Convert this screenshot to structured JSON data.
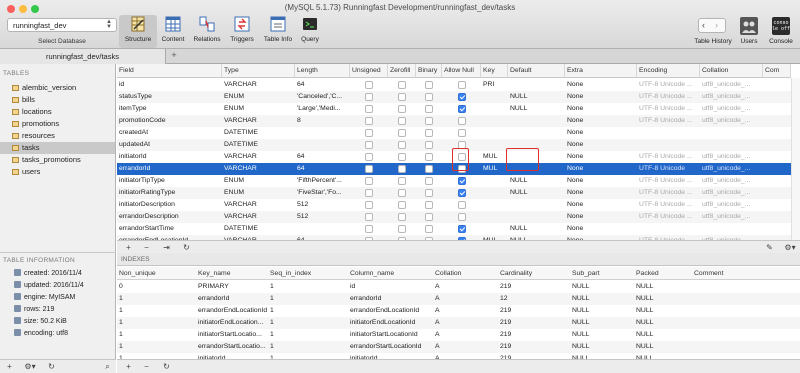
{
  "window": {
    "title": "(MySQL 5.1.73) Runningfast Development/runningfast_dev/tasks"
  },
  "toolbar": {
    "database": "runningfast_dev",
    "database_label": "Select Database",
    "buttons": [
      {
        "label": "Structure"
      },
      {
        "label": "Content"
      },
      {
        "label": "Relations"
      },
      {
        "label": "Triggers"
      },
      {
        "label": "Table Info"
      },
      {
        "label": "Query"
      }
    ],
    "right": [
      {
        "label": "Table History"
      },
      {
        "label": "Users"
      },
      {
        "label": "Console",
        "badge": "conso le off"
      }
    ]
  },
  "tab": {
    "label": "runningfast_dev/tasks",
    "add": "+"
  },
  "sidebar": {
    "tables_heading": "TABLES",
    "tables": [
      "alembic_version",
      "bills",
      "locations",
      "promotions",
      "resources",
      "tasks",
      "tasks_promotions",
      "users"
    ],
    "selected": "tasks",
    "info_heading": "TABLE INFORMATION",
    "info": [
      "created: 2016/11/4",
      "updated: 2016/11/4",
      "engine: MyISAM",
      "rows: 219",
      "size: 50.2 KiB",
      "encoding: utf8"
    ]
  },
  "structure": {
    "columns": [
      "Field",
      "Type",
      "Length",
      "Unsigned",
      "Zerofill",
      "Binary",
      "Allow Null",
      "Key",
      "Default",
      "Extra",
      "Encoding",
      "Collation",
      "Com"
    ],
    "rows": [
      {
        "field": "id",
        "type": "VARCHAR",
        "length": "64",
        "unsigned": false,
        "zerofill": false,
        "binary": false,
        "null": false,
        "key": "PRI",
        "default": "",
        "extra": "None",
        "encoding": "UTF-8 Unicode ...",
        "collation": "utf8_unicode_..."
      },
      {
        "field": "statusType",
        "type": "ENUM",
        "length": "'Canceled','C...",
        "unsigned": false,
        "zerofill": false,
        "binary": false,
        "null": true,
        "key": "",
        "default": "NULL",
        "extra": "None",
        "encoding": "UTF-8 Unicode ...",
        "collation": "utf8_unicode_..."
      },
      {
        "field": "itemType",
        "type": "ENUM",
        "length": "'Large','Medi...",
        "unsigned": false,
        "zerofill": false,
        "binary": false,
        "null": true,
        "key": "",
        "default": "NULL",
        "extra": "None",
        "encoding": "UTF-8 Unicode ...",
        "collation": "utf8_unicode_..."
      },
      {
        "field": "promotionCode",
        "type": "VARCHAR",
        "length": "8",
        "unsigned": false,
        "zerofill": false,
        "binary": false,
        "null": false,
        "key": "",
        "default": "",
        "extra": "None",
        "encoding": "UTF-8 Unicode ...",
        "collation": "utf8_unicode_..."
      },
      {
        "field": "createdAt",
        "type": "DATETIME",
        "length": "",
        "unsigned": false,
        "zerofill": false,
        "binary": false,
        "null": false,
        "key": "",
        "default": "",
        "extra": "None",
        "encoding": "",
        "collation": ""
      },
      {
        "field": "updatedAt",
        "type": "DATETIME",
        "length": "",
        "unsigned": false,
        "zerofill": false,
        "binary": false,
        "null": false,
        "key": "",
        "default": "",
        "extra": "None",
        "encoding": "",
        "collation": ""
      },
      {
        "field": "initiatorId",
        "type": "VARCHAR",
        "length": "64",
        "unsigned": false,
        "zerofill": false,
        "binary": false,
        "null": false,
        "key": "MUL",
        "default": "",
        "extra": "None",
        "encoding": "UTF-8 Unicode ...",
        "collation": "utf8_unicode_..."
      },
      {
        "field": "errandorId",
        "type": "VARCHAR",
        "length": "64",
        "unsigned": false,
        "zerofill": false,
        "binary": false,
        "null": false,
        "key": "MUL",
        "default": "",
        "extra": "None",
        "encoding": "UTF-8 Unicode",
        "collation": "utf8_unicode_..."
      },
      {
        "field": "initiatorTipType",
        "type": "ENUM",
        "length": "'FifthPercent'...",
        "unsigned": false,
        "zerofill": false,
        "binary": false,
        "null": true,
        "key": "",
        "default": "NULL",
        "extra": "None",
        "encoding": "UTF-8 Unicode ...",
        "collation": "utf8_unicode_..."
      },
      {
        "field": "initiatorRatingType",
        "type": "ENUM",
        "length": "'FiveStar','Fo...",
        "unsigned": false,
        "zerofill": false,
        "binary": false,
        "null": true,
        "key": "",
        "default": "NULL",
        "extra": "None",
        "encoding": "UTF-8 Unicode ...",
        "collation": "utf8_unicode_..."
      },
      {
        "field": "initiatorDescription",
        "type": "VARCHAR",
        "length": "512",
        "unsigned": false,
        "zerofill": false,
        "binary": false,
        "null": false,
        "key": "",
        "default": "",
        "extra": "None",
        "encoding": "UTF-8 Unicode ...",
        "collation": "utf8_unicode_..."
      },
      {
        "field": "errandorDescription",
        "type": "VARCHAR",
        "length": "512",
        "unsigned": false,
        "zerofill": false,
        "binary": false,
        "null": false,
        "key": "",
        "default": "",
        "extra": "None",
        "encoding": "UTF-8 Unicode ...",
        "collation": "utf8_unicode_..."
      },
      {
        "field": "errandorStartTime",
        "type": "DATETIME",
        "length": "",
        "unsigned": false,
        "zerofill": false,
        "binary": false,
        "null": true,
        "key": "",
        "default": "NULL",
        "extra": "None",
        "encoding": "",
        "collation": ""
      },
      {
        "field": "errandorEndLocationId",
        "type": "VARCHAR",
        "length": "64",
        "unsigned": false,
        "zerofill": false,
        "binary": false,
        "null": true,
        "key": "MUL",
        "default": "NULL",
        "extra": "None",
        "encoding": "UTF-8 Unicode ...",
        "collation": "utf8_unicode_..."
      }
    ],
    "selected_field": "errandorId"
  },
  "indexes": {
    "heading": "INDEXES",
    "columns": [
      "Non_unique",
      "Key_name",
      "Seq_in_index",
      "Column_name",
      "Collation",
      "Cardinality",
      "Sub_part",
      "Packed",
      "Comment"
    ],
    "rows": [
      [
        "0",
        "PRIMARY",
        "1",
        "id",
        "A",
        "219",
        "NULL",
        "NULL",
        ""
      ],
      [
        "1",
        "errandorId",
        "1",
        "errandorId",
        "A",
        "12",
        "NULL",
        "NULL",
        ""
      ],
      [
        "1",
        "errandorEndLocationId",
        "1",
        "errandorEndLocationId",
        "A",
        "219",
        "NULL",
        "NULL",
        ""
      ],
      [
        "1",
        "initiatorEndLocation...",
        "1",
        "initiatorEndLocationId",
        "A",
        "219",
        "NULL",
        "NULL",
        ""
      ],
      [
        "1",
        "initiatorStartLocatio...",
        "1",
        "initiatorStartLocationId",
        "A",
        "219",
        "NULL",
        "NULL",
        ""
      ],
      [
        "1",
        "errandorStartLocatio...",
        "1",
        "errandorStartLocationId",
        "A",
        "219",
        "NULL",
        "NULL",
        ""
      ],
      [
        "1",
        "initiatorId",
        "1",
        "initiatorId",
        "A",
        "219",
        "NULL",
        "NULL",
        ""
      ]
    ]
  }
}
